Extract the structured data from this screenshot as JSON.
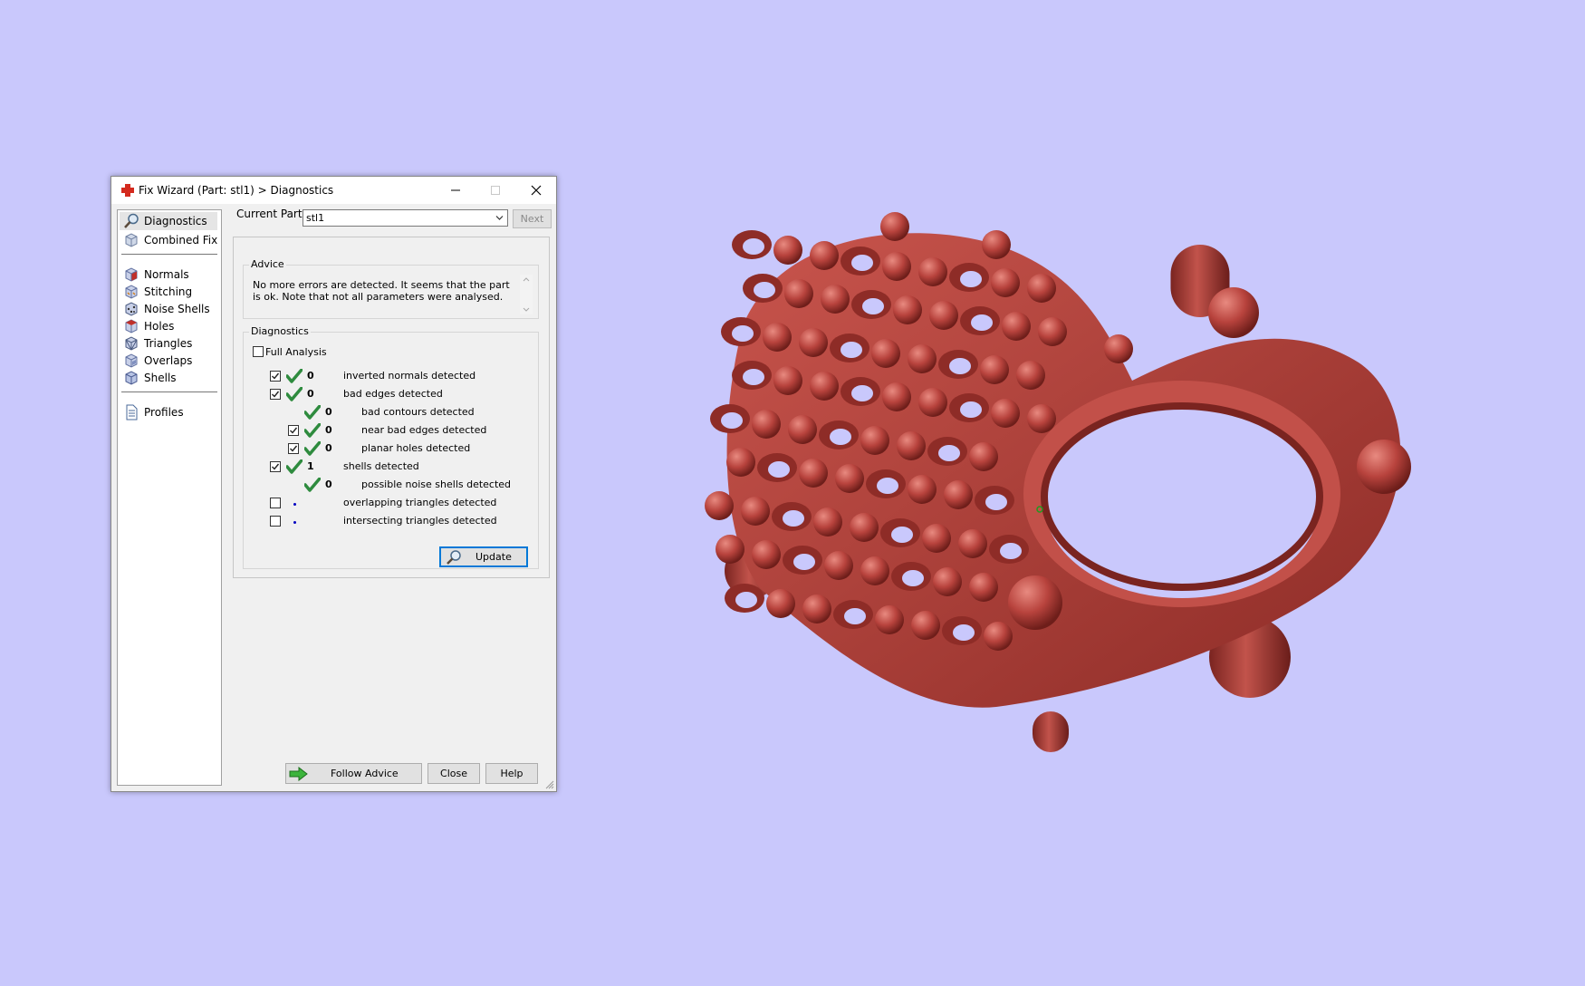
{
  "window": {
    "title": "Fix Wizard (Part: stl1) > Diagnostics",
    "icon": "red-cross-icon",
    "controls": [
      "minimize-icon",
      "maximize-icon",
      "close-icon"
    ]
  },
  "sidebar": {
    "items": [
      {
        "label": "Diagnostics",
        "icon": "magnifier-icon",
        "selected": true
      },
      {
        "label": "Combined Fix",
        "icon": "cube-icon"
      },
      {
        "label": "Normals",
        "icon": "normals-cube-icon"
      },
      {
        "label": "Stitching",
        "icon": "stitching-cube-icon"
      },
      {
        "label": "Noise Shells",
        "icon": "noise-shells-icon"
      },
      {
        "label": "Holes",
        "icon": "holes-cube-icon"
      },
      {
        "label": "Triangles",
        "icon": "triangles-cube-icon"
      },
      {
        "label": "Overlaps",
        "icon": "overlaps-cube-icon"
      },
      {
        "label": "Shells",
        "icon": "shells-cube-icon"
      },
      {
        "label": "Profiles",
        "icon": "document-icon"
      }
    ]
  },
  "current_part": {
    "label": "Current Part:",
    "value": "stl1",
    "next_label": "Next"
  },
  "advice": {
    "legend": "Advice",
    "text": "No more errors are detected. It seems that the part is ok. Note that not all parameters were analysed."
  },
  "diagnostics": {
    "legend": "Diagnostics",
    "full_analysis_label": "Full Analysis",
    "full_analysis_checked": false,
    "rows": [
      {
        "count": "0",
        "label": "inverted normals detected",
        "checked": true,
        "has_checkbox": true,
        "status": "ok",
        "indent": 0
      },
      {
        "count": "0",
        "label": "bad edges detected",
        "checked": true,
        "has_checkbox": true,
        "status": "ok",
        "indent": 0
      },
      {
        "count": "0",
        "label": "bad contours detected",
        "checked": false,
        "has_checkbox": false,
        "status": "ok",
        "indent": 1
      },
      {
        "count": "0",
        "label": "near bad edges detected",
        "checked": true,
        "has_checkbox": true,
        "status": "ok",
        "indent": 1
      },
      {
        "count": "0",
        "label": "planar holes detected",
        "checked": true,
        "has_checkbox": true,
        "status": "ok",
        "indent": 1
      },
      {
        "count": "1",
        "label": "shells detected",
        "checked": true,
        "has_checkbox": true,
        "status": "ok",
        "indent": 0
      },
      {
        "count": "0",
        "label": "possible noise shells detected",
        "checked": false,
        "has_checkbox": false,
        "status": "ok",
        "indent": 1
      },
      {
        "count": "",
        "label": "overlapping triangles detected",
        "checked": false,
        "has_checkbox": true,
        "status": "unknown",
        "indent": 0
      },
      {
        "count": "",
        "label": "intersecting triangles detected",
        "checked": false,
        "has_checkbox": true,
        "status": "unknown",
        "indent": 0
      }
    ],
    "update_label": "Update"
  },
  "footer": {
    "follow_advice_label": "Follow Advice",
    "close_label": "Close",
    "help_label": "Help"
  },
  "colors": {
    "background": "#c9c8fc",
    "model": "#b8433d",
    "ok_tick": "#2e8b3e",
    "accent": "#0078d7"
  }
}
